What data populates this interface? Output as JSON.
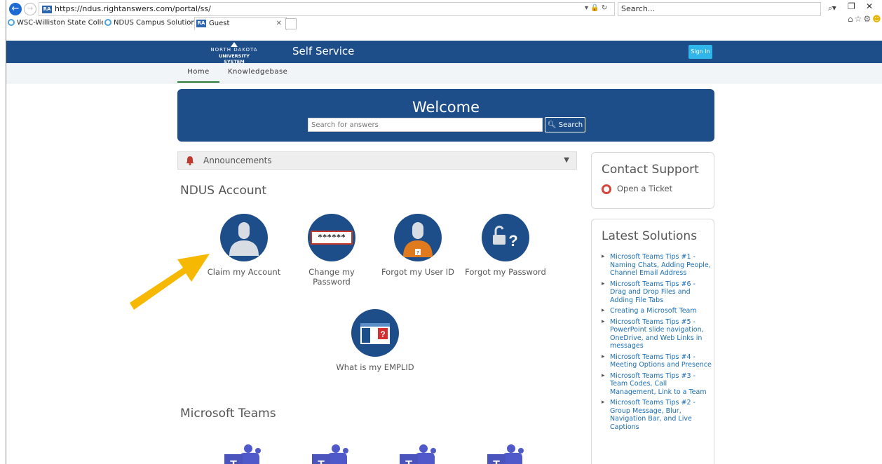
{
  "browser": {
    "url": "https://ndus.rightanswers.com/portal/ss/",
    "url_host": "https://ndus.rightanswers.com",
    "url_path": "/portal/ss/",
    "search_placeholder": "Search...",
    "tabs": [
      {
        "label": "WSC-Williston State College H..."
      },
      {
        "label": "NDUS Campus Solutions - Log..."
      },
      {
        "label": "Guest"
      }
    ]
  },
  "site": {
    "logo_line1": "NORTH DAKOTA",
    "logo_line2": "UNIVERSITY SYSTEM",
    "title": "Self Service",
    "sign_in": "Sign In",
    "nav": [
      {
        "label": "Home"
      },
      {
        "label": "Knowledgebase"
      }
    ]
  },
  "welcome": {
    "title": "Welcome",
    "search_placeholder": "Search for answers",
    "search_button": "Search"
  },
  "announcements": {
    "label": "Announcements"
  },
  "ndus_account": {
    "heading": "NDUS Account",
    "tiles": [
      {
        "label": "Claim my Account"
      },
      {
        "label": "Change my Password",
        "mask": "******"
      },
      {
        "label": "Forgot my User ID"
      },
      {
        "label": "Forgot my Password"
      },
      {
        "label": "What is my EMPLID"
      }
    ]
  },
  "microsoft_teams": {
    "heading": "Microsoft Teams"
  },
  "contact_support": {
    "title": "Contact Support",
    "open_ticket": "Open a Ticket"
  },
  "latest_solutions": {
    "title": "Latest Solutions",
    "items": [
      {
        "label": "Microsoft Teams Tips #1 - Naming Chats, Adding People, Channel Email Address"
      },
      {
        "label": "Microsoft Teams Tips #6 - Drag and Drop Files and Adding File Tabs"
      },
      {
        "label": "Creating a Microsoft Team"
      },
      {
        "label": "Microsoft Teams Tips #5 - PowerPoint slide navigation, OneDrive, and Web Links in messages"
      },
      {
        "label": "Microsoft Teams Tips #4 - Meeting Options and Presence"
      },
      {
        "label": "Microsoft Teams Tips #3 - Team Codes, Call Management, Link to a Team"
      },
      {
        "label": "Microsoft Teams Tips #2 - Group Message, Blur, Navigation Bar, and Live Captions"
      }
    ]
  },
  "colors": {
    "brand": "#1d4e89",
    "signin": "#2fb5ea",
    "link": "#1a6eb5",
    "arrow": "#f6b800",
    "bell": "#c0392b"
  }
}
